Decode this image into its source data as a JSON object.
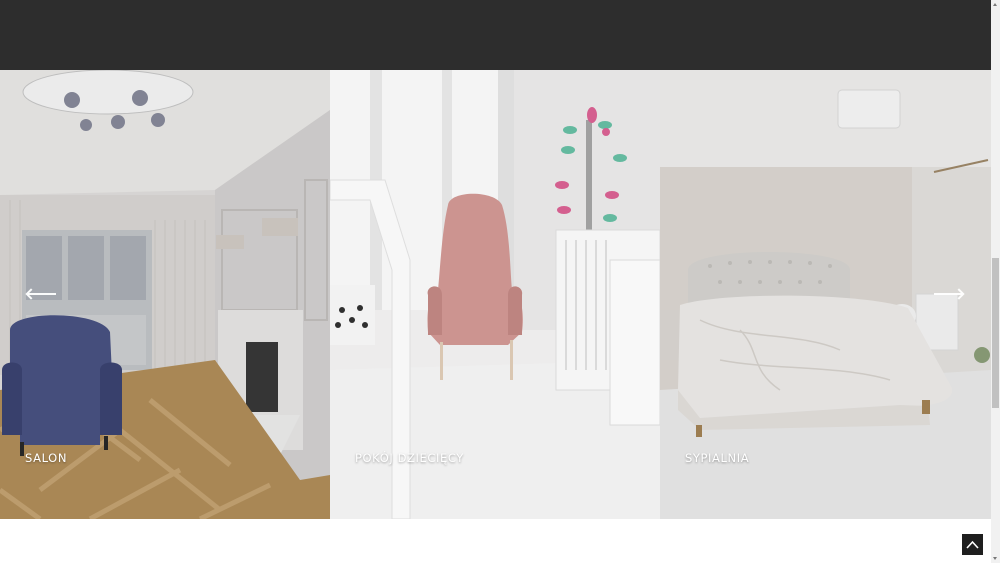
{
  "gallery": {
    "tiles": [
      {
        "label": "SALON"
      },
      {
        "label": "POKÓJ DZIECIĘCY"
      },
      {
        "label": "SYPIALNIA"
      }
    ]
  },
  "icons": {
    "prev": "arrow-left-icon",
    "next": "arrow-right-icon",
    "back_to_top": "chevron-up-icon"
  },
  "colors": {
    "top_band": "#2d2d2d",
    "back_to_top": "#1e1e1e",
    "label_text": "#ffffff"
  }
}
